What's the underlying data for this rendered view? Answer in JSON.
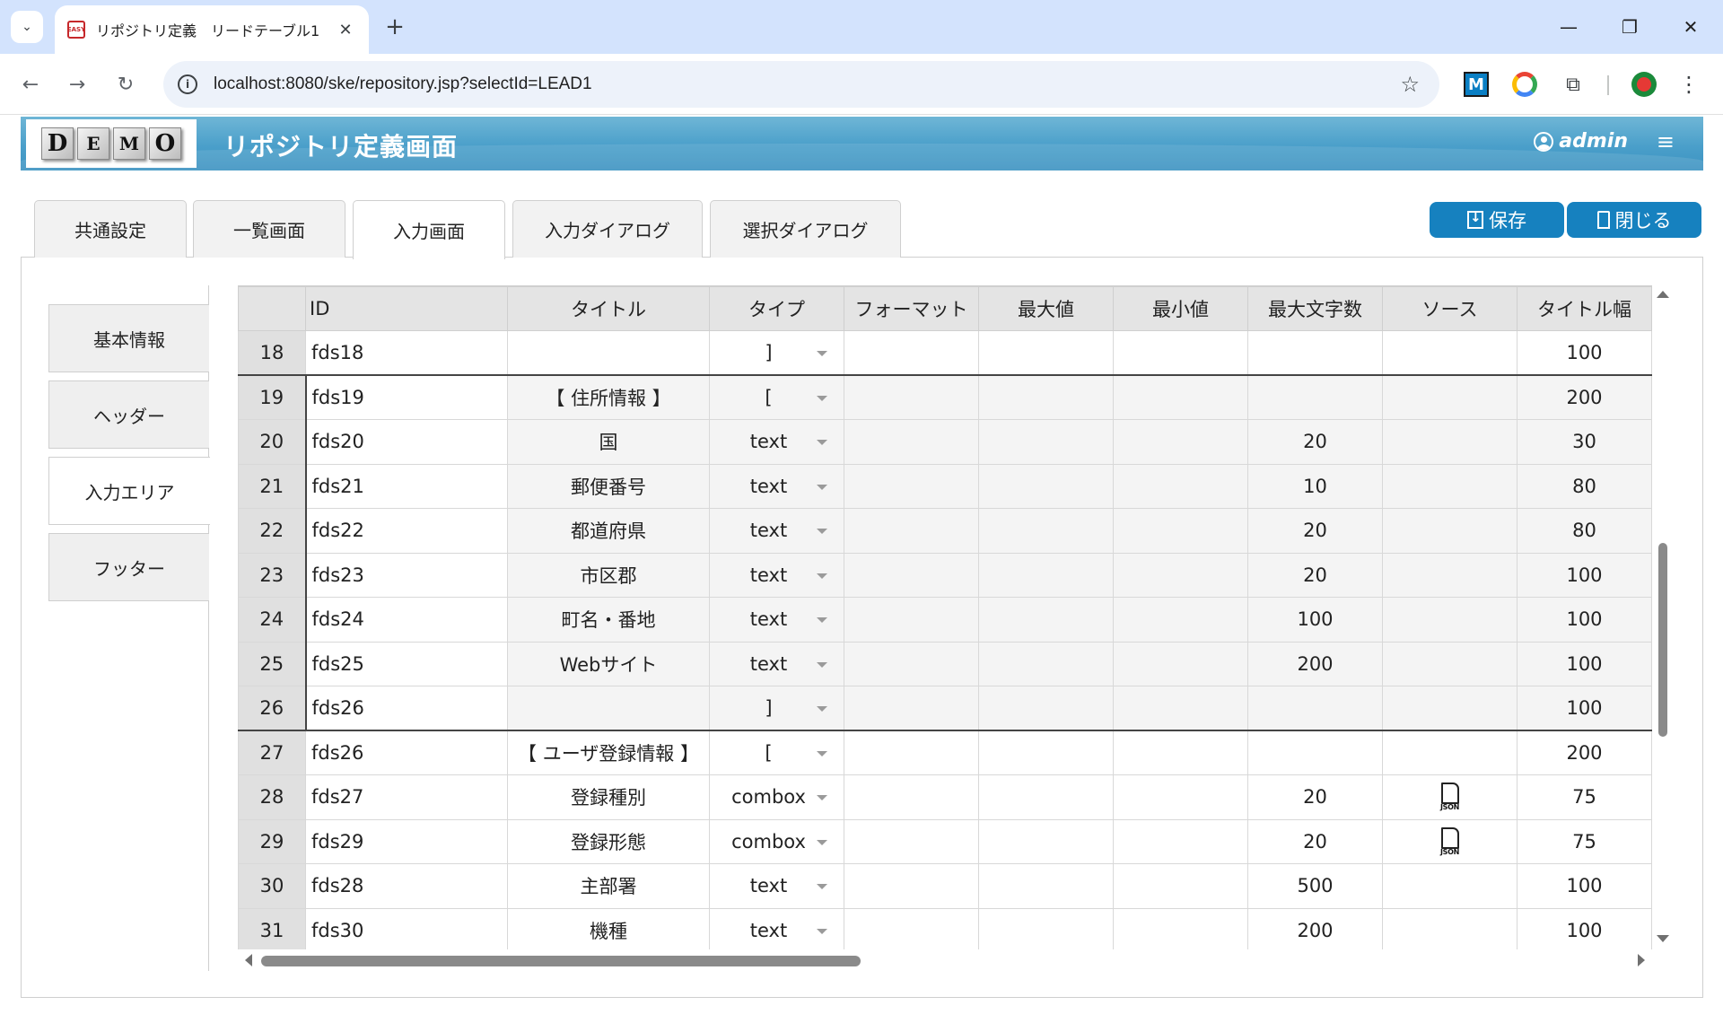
{
  "browser": {
    "tab_title": "リポジトリ定義　リードテーブル1",
    "favicon_text": "EASY",
    "url": "localhost:8080/ske/repository.jsp?selectId=LEAD1",
    "ext_m_label": "M"
  },
  "header": {
    "logo_letters": [
      "D",
      "E",
      "M",
      "O"
    ],
    "title": "リポジトリ定義画面",
    "user": "admin"
  },
  "main_tabs": [
    {
      "label": "共通設定"
    },
    {
      "label": "一覧画面"
    },
    {
      "label": "入力画面",
      "active": true
    },
    {
      "label": "入力ダイアログ"
    },
    {
      "label": "選択ダイアログ"
    }
  ],
  "actions": {
    "save_label": "保存",
    "close_label": "閉じる"
  },
  "side_tabs": [
    {
      "label": "基本情報"
    },
    {
      "label": "ヘッダー"
    },
    {
      "label": "入力エリア",
      "active": true
    },
    {
      "label": "フッター"
    }
  ],
  "grid": {
    "columns": [
      "ID",
      "タイトル",
      "タイプ",
      "フォーマット",
      "最大値",
      "最小値",
      "最大文字数",
      "ソース",
      "タイトル幅"
    ],
    "rows": [
      {
        "num": "18",
        "id": "fds18",
        "title": "",
        "type": "]",
        "format": "",
        "max": "",
        "min": "",
        "maxlen": "",
        "source": "",
        "title_width": "100"
      },
      {
        "num": "19",
        "id": "fds19",
        "title": "【 住所情報 】",
        "type": "[",
        "format": "",
        "max": "",
        "min": "",
        "maxlen": "",
        "source": "",
        "title_width": "200"
      },
      {
        "num": "20",
        "id": "fds20",
        "title": "国",
        "type": "text",
        "format": "",
        "max": "",
        "min": "",
        "maxlen": "20",
        "source": "",
        "title_width": "30"
      },
      {
        "num": "21",
        "id": "fds21",
        "title": "郵便番号",
        "type": "text",
        "format": "",
        "max": "",
        "min": "",
        "maxlen": "10",
        "source": "",
        "title_width": "80"
      },
      {
        "num": "22",
        "id": "fds22",
        "title": "都道府県",
        "type": "text",
        "format": "",
        "max": "",
        "min": "",
        "maxlen": "20",
        "source": "",
        "title_width": "80"
      },
      {
        "num": "23",
        "id": "fds23",
        "title": "市区郡",
        "type": "text",
        "format": "",
        "max": "",
        "min": "",
        "maxlen": "20",
        "source": "",
        "title_width": "100"
      },
      {
        "num": "24",
        "id": "fds24",
        "title": "町名・番地",
        "type": "text",
        "format": "",
        "max": "",
        "min": "",
        "maxlen": "100",
        "source": "",
        "title_width": "100"
      },
      {
        "num": "25",
        "id": "fds25",
        "title": "Webサイト",
        "type": "text",
        "format": "",
        "max": "",
        "min": "",
        "maxlen": "200",
        "source": "",
        "title_width": "100"
      },
      {
        "num": "26",
        "id": "fds26",
        "title": "",
        "type": "]",
        "format": "",
        "max": "",
        "min": "",
        "maxlen": "",
        "source": "",
        "title_width": "100"
      },
      {
        "num": "27",
        "id": "fds26",
        "title": "【 ユーザ登録情報 】",
        "type": "[",
        "format": "",
        "max": "",
        "min": "",
        "maxlen": "",
        "source": "",
        "title_width": "200"
      },
      {
        "num": "28",
        "id": "fds27",
        "title": "登録種別",
        "type": "combox",
        "format": "",
        "max": "",
        "min": "",
        "maxlen": "20",
        "source": "json-file-icon",
        "title_width": "75"
      },
      {
        "num": "29",
        "id": "fds29",
        "title": "登録形態",
        "type": "combox",
        "format": "",
        "max": "",
        "min": "",
        "maxlen": "20",
        "source": "json-file-icon",
        "title_width": "75"
      },
      {
        "num": "30",
        "id": "fds28",
        "title": "主部署",
        "type": "text",
        "format": "",
        "max": "",
        "min": "",
        "maxlen": "500",
        "source": "",
        "title_width": "100"
      },
      {
        "num": "31",
        "id": "fds30",
        "title": "機種",
        "type": "text",
        "format": "",
        "max": "",
        "min": "",
        "maxlen": "200",
        "source": "",
        "title_width": "100"
      }
    ],
    "json_icon_label": "JSON"
  },
  "colors": {
    "header_blue": "#4a9fca",
    "button_blue": "#1681bf",
    "tabstrip": "#d3e3fd",
    "group_border": "#444444"
  }
}
